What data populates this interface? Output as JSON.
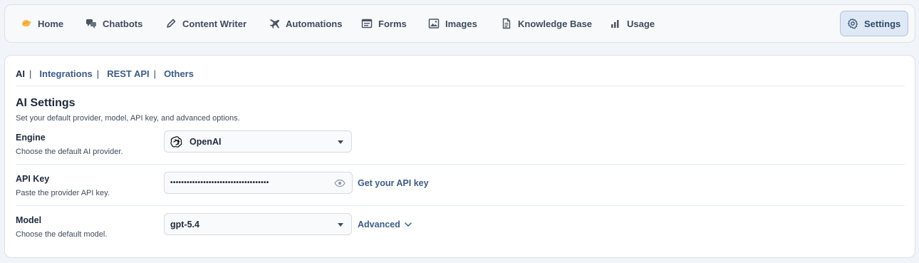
{
  "nav": {
    "items": [
      {
        "label": "Home",
        "icon": "home-icon"
      },
      {
        "label": "Chatbots",
        "icon": "chat-bubbles-icon"
      },
      {
        "label": "Content Writer",
        "icon": "pencil-icon"
      },
      {
        "label": "Automations",
        "icon": "plane-icon"
      },
      {
        "label": "Forms",
        "icon": "form-icon"
      },
      {
        "label": "Images",
        "icon": "image-icon"
      },
      {
        "label": "Knowledge Base",
        "icon": "document-icon"
      },
      {
        "label": "Usage",
        "icon": "bar-chart-icon"
      }
    ],
    "settings": {
      "label": "Settings",
      "icon": "gear-icon",
      "active": true
    }
  },
  "subtabs": [
    {
      "label": "AI",
      "active": true
    },
    {
      "label": "Integrations"
    },
    {
      "label": "REST API"
    },
    {
      "label": "Others"
    }
  ],
  "separator": "|",
  "section": {
    "title": "AI Settings",
    "description": "Set your default provider, model, API key, and advanced options."
  },
  "engine": {
    "label": "Engine",
    "help": "Choose the default AI provider.",
    "value": "OpenAI",
    "icon": "openai-logo-icon"
  },
  "api_key": {
    "label": "API Key",
    "help": "Paste the provider API key.",
    "masked_value": "••••••••••••••••••••••••••••••••••••",
    "link": "Get your API key",
    "icon": "eye-icon"
  },
  "model": {
    "label": "Model",
    "help": "Choose the default model.",
    "value": "gpt-5.4",
    "advanced_label": "Advanced"
  },
  "colors": {
    "accent": "#3b5b86",
    "active_bg": "#dfe9f5",
    "border": "#dbe2ea",
    "page_bg": "#f1f4f8"
  }
}
